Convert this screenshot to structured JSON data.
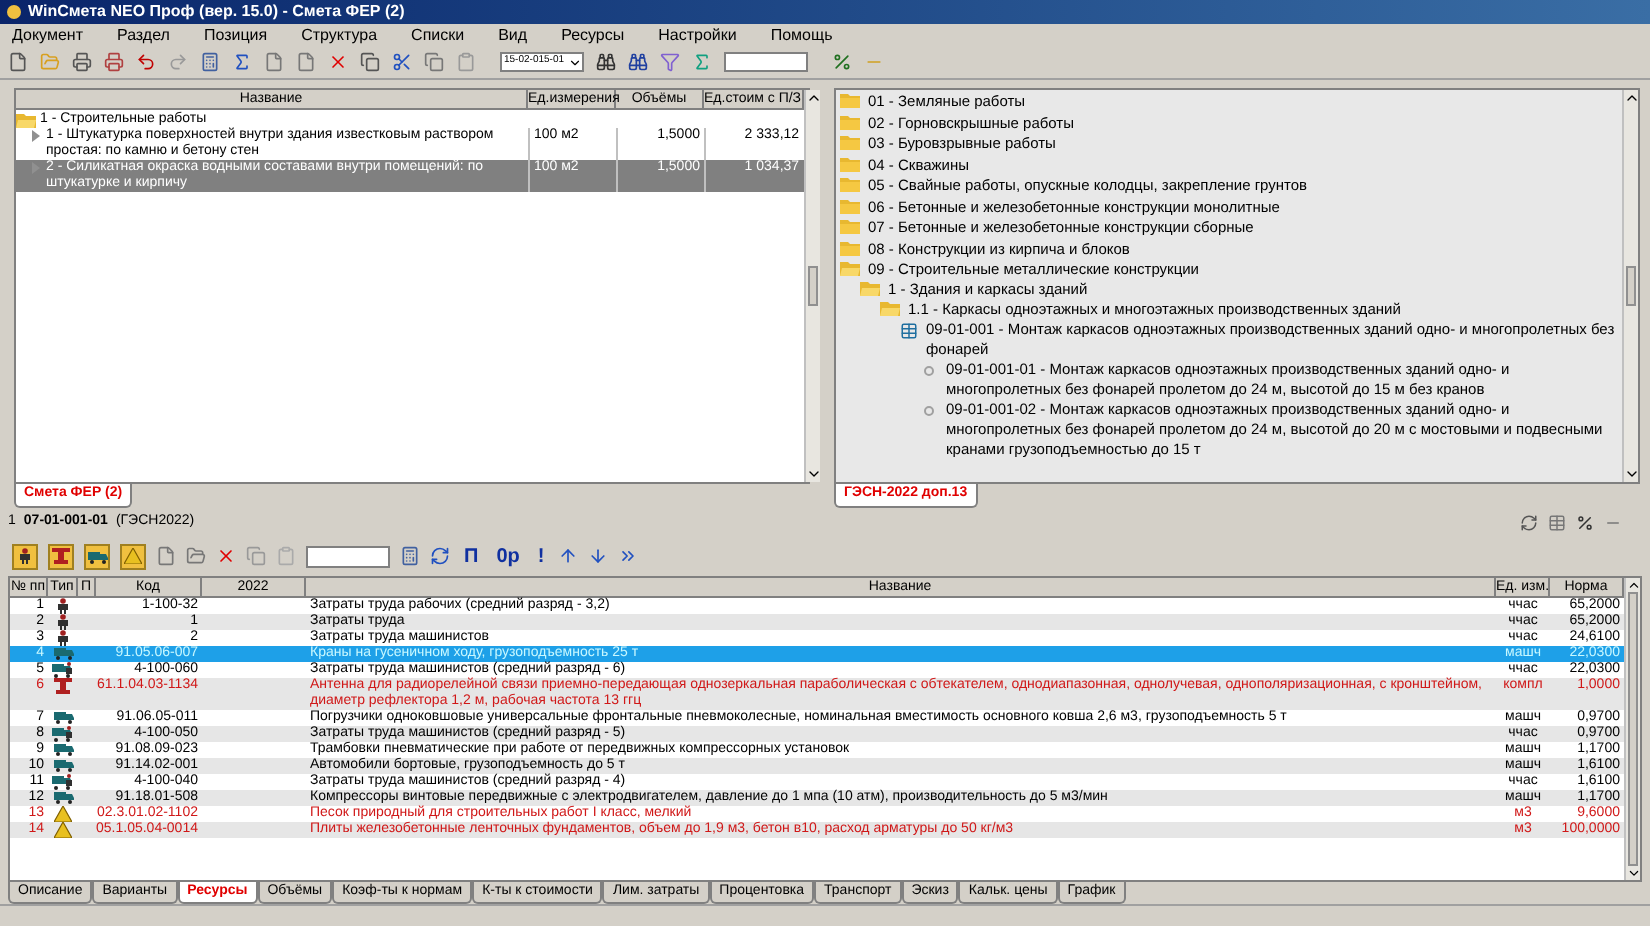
{
  "window": {
    "title": "WinСмета NEO Проф (вер. 15.0) - Смета ФЕР (2)"
  },
  "menu": [
    "Документ",
    "Раздел",
    "Позиция",
    "Структура",
    "Списки",
    "Вид",
    "Ресурсы",
    "Настройки",
    "Помощь"
  ],
  "toolbar": {
    "date_field": "15-02-015-01"
  },
  "estimate_panel": {
    "columns": [
      "Название",
      "Ед.измерения",
      "Объёмы",
      "Ед.стоим с П/З"
    ],
    "rows": [
      {
        "name": "1 - Строительные работы",
        "children": [
          {
            "name": "1 - Штукатурка поверхностей внутри здания известковым раствором простая: по камню и бетону стен",
            "unit": "100 м2",
            "volume": "1,5000",
            "cost": "2 333,12",
            "selected": false
          },
          {
            "name": "2 - Силикатная окраска водными составами внутри помещений: по штукатурке и кирпичу",
            "unit": "100 м2",
            "volume": "1,5000",
            "cost": "1 034,37",
            "selected": true
          }
        ]
      }
    ],
    "tabs": [
      {
        "label": "Смета ФЕР (2)",
        "selected": true
      }
    ]
  },
  "catalog_panel": {
    "tree": [
      {
        "kind": "folder",
        "label": "01 - Земляные работы",
        "expanded": false
      },
      {
        "kind": "folder",
        "label": "02 - Горновскрышные работы",
        "expanded": false
      },
      {
        "kind": "folder",
        "label": "03 - Буровзрывные работы",
        "expanded": false
      },
      {
        "kind": "folder",
        "label": "04 - Скважины",
        "expanded": false
      },
      {
        "kind": "folder",
        "label": "05 - Свайные работы, опускные колодцы, закрепление грунтов",
        "expanded": false
      },
      {
        "kind": "folder",
        "label": "06 - Бетонные и железобетонные конструкции монолитные",
        "expanded": false
      },
      {
        "kind": "folder",
        "label": "07 - Бетонные и железобетонные конструкции сборные",
        "expanded": false
      },
      {
        "kind": "folder",
        "label": "08 - Конструкции из кирпича и блоков",
        "expanded": false
      },
      {
        "kind": "folder",
        "label": "09 - Строительные металлические конструкции",
        "expanded": true,
        "children": [
          {
            "kind": "folder",
            "label": "1 - Здания и каркасы зданий",
            "expanded": true,
            "children": [
              {
                "kind": "folder",
                "label": "1.1 - Каркасы одноэтажных и многоэтажных производственных зданий",
                "expanded": true,
                "children": [
                  {
                    "kind": "table",
                    "label": "09-01-001 - Монтаж каркасов одноэтажных производственных зданий одно- и многопролетных без фонарей",
                    "children": [
                      {
                        "kind": "leaf",
                        "label": "09-01-001-01 - Монтаж каркасов одноэтажных производственных зданий одно- и многопролетных без фонарей пролетом до 24 м, высотой до 15 м без кранов"
                      },
                      {
                        "kind": "leaf",
                        "label": "09-01-001-02 - Монтаж каркасов одноэтажных производственных зданий одно- и многопролетных без фонарей пролетом до 24 м, высотой до 20 м с мостовыми и подвесными кранами грузоподъемностью до 15 т"
                      }
                    ]
                  }
                ]
              }
            ]
          }
        ]
      }
    ],
    "tabs": [
      {
        "label": "ГЭСН-2022 доп.13",
        "selected": true
      }
    ]
  },
  "position_bar": {
    "number": "1",
    "code": "07-01-001-01",
    "base": "(ГЭСН2022)"
  },
  "resource_toolbar": {
    "text_buttons": [
      "П",
      "0р",
      "!"
    ]
  },
  "resources_table": {
    "columns": [
      "№ пп",
      "Тип",
      "П",
      "Код",
      "2022",
      "Название",
      "Ед. изм.",
      "Норма"
    ],
    "rows": [
      {
        "n": "1",
        "kind": "worker",
        "code": "1-100-32",
        "name": "Затраты труда рабочих (средний разряд - 3,2)",
        "unit": "ччас",
        "norm": "65,2000",
        "selected": false
      },
      {
        "n": "2",
        "kind": "worker",
        "code": "1",
        "name": "Затраты труда",
        "unit": "ччас",
        "norm": "65,2000",
        "selected": false
      },
      {
        "n": "3",
        "kind": "worker",
        "code": "2",
        "name": "Затраты труда машинистов",
        "unit": "ччас",
        "norm": "24,6100",
        "selected": false
      },
      {
        "n": "4",
        "kind": "machine",
        "code": "91.05.06-007",
        "name": "Краны на гусеничном ходу, грузоподъемность 25 т",
        "unit": "машч",
        "norm": "22,0300",
        "selected": true
      },
      {
        "n": "5",
        "kind": "machinist",
        "code": "4-100-060",
        "name": "Затраты труда машинистов (средний разряд - 6)",
        "unit": "ччас",
        "norm": "22,0300",
        "selected": false
      },
      {
        "n": "6",
        "kind": "equipment",
        "code": "61.1.04.03-1134",
        "name": "Антенна для радиорелейной связи приемно-передающая однозеркальная параболическая с обтекателем, однодиапазонная, однолучевая, однополяризационная, с кронштейном, диаметр рефлектора 1,2 м, рабочая частота 13 ггц",
        "unit": "компл",
        "norm": "1,0000",
        "selected": false
      },
      {
        "n": "7",
        "kind": "machine",
        "code": "91.06.05-011",
        "name": "Погрузчики одноковшовые универсальные фронтальные пневмоколесные, номинальная вместимость основного ковша 2,6 м3, грузоподъемность 5 т",
        "unit": "машч",
        "norm": "0,9700",
        "selected": false
      },
      {
        "n": "8",
        "kind": "machinist",
        "code": "4-100-050",
        "name": "Затраты труда машинистов (средний разряд - 5)",
        "unit": "ччас",
        "norm": "0,9700",
        "selected": false
      },
      {
        "n": "9",
        "kind": "machine",
        "code": "91.08.09-023",
        "name": "Трамбовки пневматические при работе от передвижных компрессорных установок",
        "unit": "машч",
        "norm": "1,1700",
        "selected": false
      },
      {
        "n": "10",
        "kind": "machine",
        "code": "91.14.02-001",
        "name": "Автомобили бортовые, грузоподъемность до 5 т",
        "unit": "машч",
        "norm": "1,6100",
        "selected": false
      },
      {
        "n": "11",
        "kind": "machinist",
        "code": "4-100-040",
        "name": "Затраты труда машинистов (средний разряд - 4)",
        "unit": "ччас",
        "norm": "1,6100",
        "selected": false
      },
      {
        "n": "12",
        "kind": "machine",
        "code": "91.18.01-508",
        "name": "Компрессоры винтовые передвижные с электродвигателем, давление до 1 мпа (10 атм), производительность до 5 м3/мин",
        "unit": "машч",
        "norm": "1,1700",
        "selected": false
      },
      {
        "n": "13",
        "kind": "material",
        "code": "02.3.01.02-1102",
        "name": "Песок природный для строительных работ I класс, мелкий",
        "unit": "м3",
        "norm": "9,6000",
        "selected": false
      },
      {
        "n": "14",
        "kind": "material",
        "code": "05.1.05.04-0014",
        "name": "Плиты железобетонные ленточных фундаментов, объем до 1,9 м3, бетон в10, расход арматуры до 50 кг/м3",
        "unit": "м3",
        "norm": "100,0000",
        "selected": false
      }
    ]
  },
  "bottom_tabs": [
    {
      "label": "Описание",
      "selected": false
    },
    {
      "label": "Варианты",
      "selected": false
    },
    {
      "label": "Ресурсы",
      "selected": true
    },
    {
      "label": "Объёмы",
      "selected": false
    },
    {
      "label": "Коэф-ты к нормам",
      "selected": false
    },
    {
      "label": "К-ты к стоимости",
      "selected": false
    },
    {
      "label": "Лим. затраты",
      "selected": false
    },
    {
      "label": "Процентовка",
      "selected": false
    },
    {
      "label": "Транспорт",
      "selected": false
    },
    {
      "label": "Эскиз",
      "selected": false
    },
    {
      "label": "Кальк. цены",
      "selected": false
    },
    {
      "label": "График",
      "selected": false
    }
  ]
}
